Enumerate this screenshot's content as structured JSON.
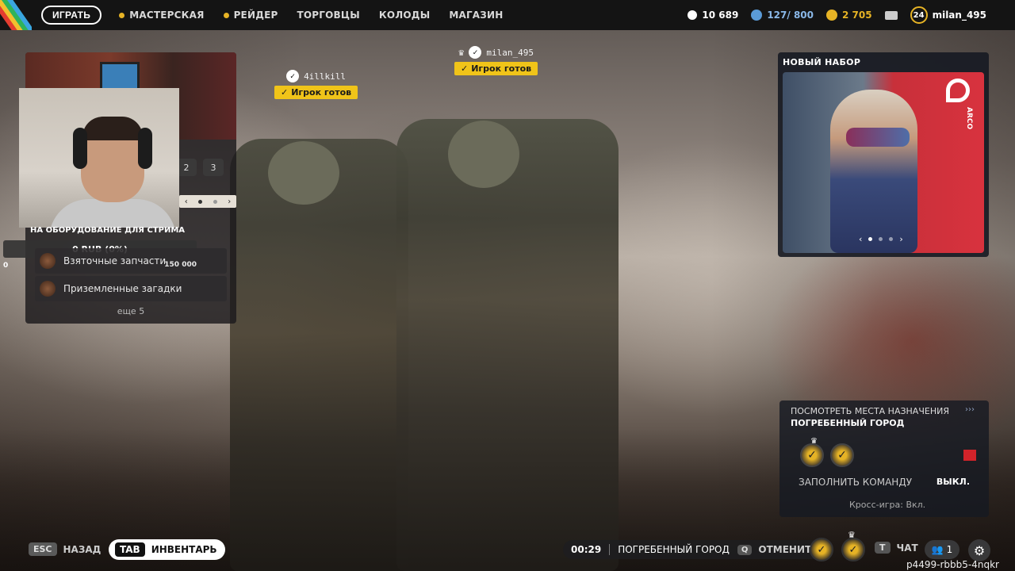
{
  "topbar": {
    "play": "ИГРАТЬ",
    "nav": [
      "МАСТЕРСКАЯ",
      "РЕЙДЕР",
      "ТОРГОВЦЫ",
      "КОЛОДЫ",
      "МАГАЗИН"
    ],
    "coins": "10 689",
    "cred": "127/ 800",
    "gold": "2 705",
    "level": "24",
    "username": "milan_495"
  },
  "left_panel": {
    "pages": [
      "2",
      "3"
    ],
    "donation_title": "НА ОБОРУДОВАНИЕ ДЛЯ СТРИМА",
    "donation_amount": "0 RUB (0%)",
    "zero_label": "0",
    "tasks": [
      {
        "label": "Взяточные запчасти",
        "value": "150 000"
      },
      {
        "label": "Приземленные загадки",
        "value": ""
      }
    ],
    "more": "еще 5"
  },
  "players": [
    {
      "name": "4illkill",
      "status": "Игрок готов"
    },
    {
      "name": "milan_495",
      "status": "Игрок готов"
    }
  ],
  "bundle": {
    "title": "НОВЫЙ НАБОР",
    "brand": "ARCO"
  },
  "destination": {
    "link": "ПОСМОТРЕТЬ МЕСТА НАЗНАЧЕНИЯ",
    "arrows": "›››",
    "city": "ПОГРЕБЕННЫЙ ГОРОД",
    "fill_label": "ЗАПОЛНИТЬ КОМАНДУ",
    "fill_value": "ВЫКЛ.",
    "crossplay": "Кросс-игра: Вкл."
  },
  "bottombar": {
    "esc_key": "ESC",
    "back": "НАЗАД",
    "tab_key": "TAB",
    "inventory": "ИНВЕНТАРЬ",
    "timer": "00:29",
    "city": "ПОГРЕБЕННЫЙ ГОРОД",
    "cancel_key": "Q",
    "cancel": "ОТМЕНИТЬ",
    "chat_key": "T",
    "chat": "ЧАТ",
    "friends_count": "1",
    "session_id": "p4499-rbbb5-4nqkr"
  },
  "colors": {
    "accent": "#e6b325",
    "ready": "#f0c419",
    "topbar": "#141414"
  }
}
